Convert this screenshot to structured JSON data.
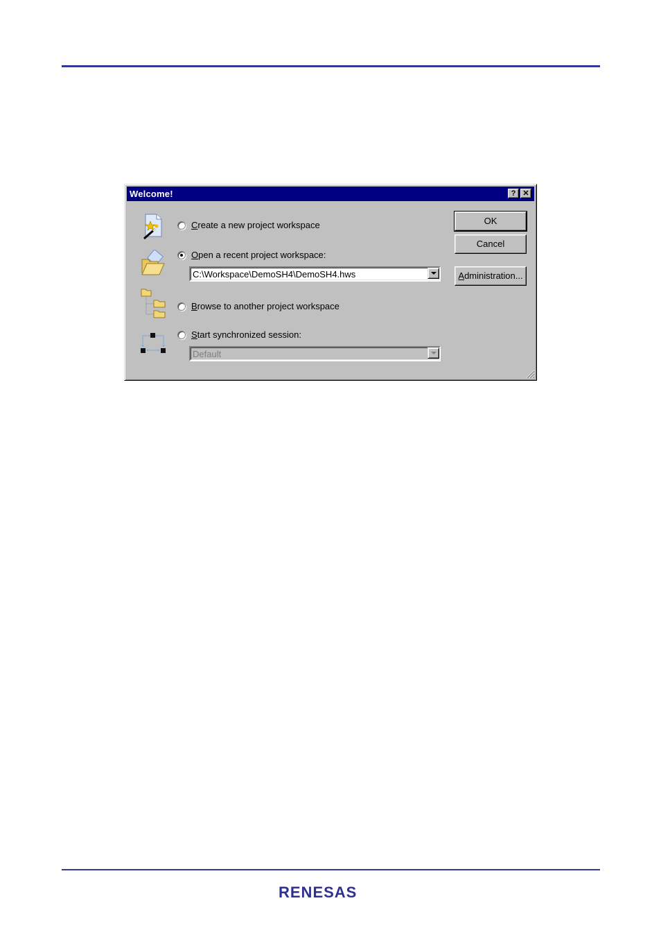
{
  "dialog": {
    "title": "Welcome!",
    "help_button": "?",
    "close_button": "✕",
    "options": [
      {
        "label_underline": "C",
        "label_rest": "reate a new project workspace",
        "checked": false,
        "icon": "new-workspace-wizard-icon"
      },
      {
        "label_underline": "O",
        "label_rest": "pen a recent project workspace:",
        "checked": true,
        "icon": "open-folder-icon"
      },
      {
        "label_underline": "B",
        "label_rest": "rowse to another project workspace",
        "checked": false,
        "icon": "folder-tree-icon"
      },
      {
        "label_underline": "S",
        "label_rest": "tart synchronized session:",
        "checked": false,
        "icon": "synchronized-session-icon"
      }
    ],
    "recent_workspace": {
      "value": "C:\\Workspace\\DemoSH4\\DemoSH4.hws"
    },
    "session": {
      "value": "Default",
      "disabled": true
    },
    "buttons": {
      "ok": "OK",
      "cancel": "Cancel",
      "admin_underline": "A",
      "admin_rest": "dministration..."
    }
  },
  "footer": {
    "logo_text": "RENESAS"
  },
  "colors": {
    "rule": "#2e3a94",
    "titlebar": "#000080",
    "dialog_bg": "#c0c0c0",
    "logo": "#2e3192"
  }
}
